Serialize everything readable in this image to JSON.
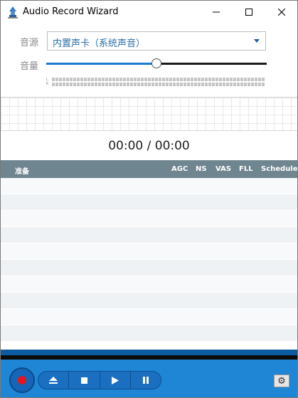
{
  "window": {
    "title": "Audio Record Wizard"
  },
  "source": {
    "label": "音源",
    "value": "内置声卡（系统声音）"
  },
  "volume": {
    "label": "音量",
    "level_percent": 50
  },
  "meter": {
    "left_label": "L",
    "right_label": "R"
  },
  "time": {
    "display": "00:00 / 00:00"
  },
  "table": {
    "columns": {
      "status": "准备",
      "agc": "AGC",
      "ns": "NS",
      "vas": "VAS",
      "fll": "FLL",
      "schedule": "Schedule"
    }
  },
  "icons": {
    "app": "app-icon",
    "minimize": "minimize-icon",
    "maximize": "maximize-icon",
    "close": "close-icon",
    "record": "record-icon",
    "eject": "eject-icon",
    "stop": "stop-icon",
    "play": "play-icon",
    "pause": "pause-icon",
    "settings": "gear-icon"
  },
  "colors": {
    "accent": "#1f86d6",
    "record": "#e8131b",
    "header": "#6f8590"
  }
}
